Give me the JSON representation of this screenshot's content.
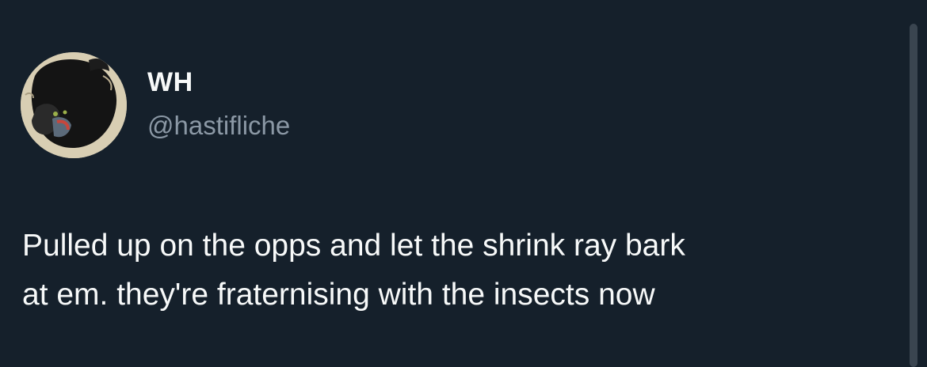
{
  "author": {
    "display_name": "WH",
    "handle": "@hastifliche"
  },
  "tweet": {
    "text": "Pulled up on the opps and let the shrink ray bark\nat em. they're fraternising with the insects now"
  },
  "colors": {
    "background": "#15202b",
    "primary_text": "#f7f9f9",
    "secondary_text": "#8b98a5"
  }
}
